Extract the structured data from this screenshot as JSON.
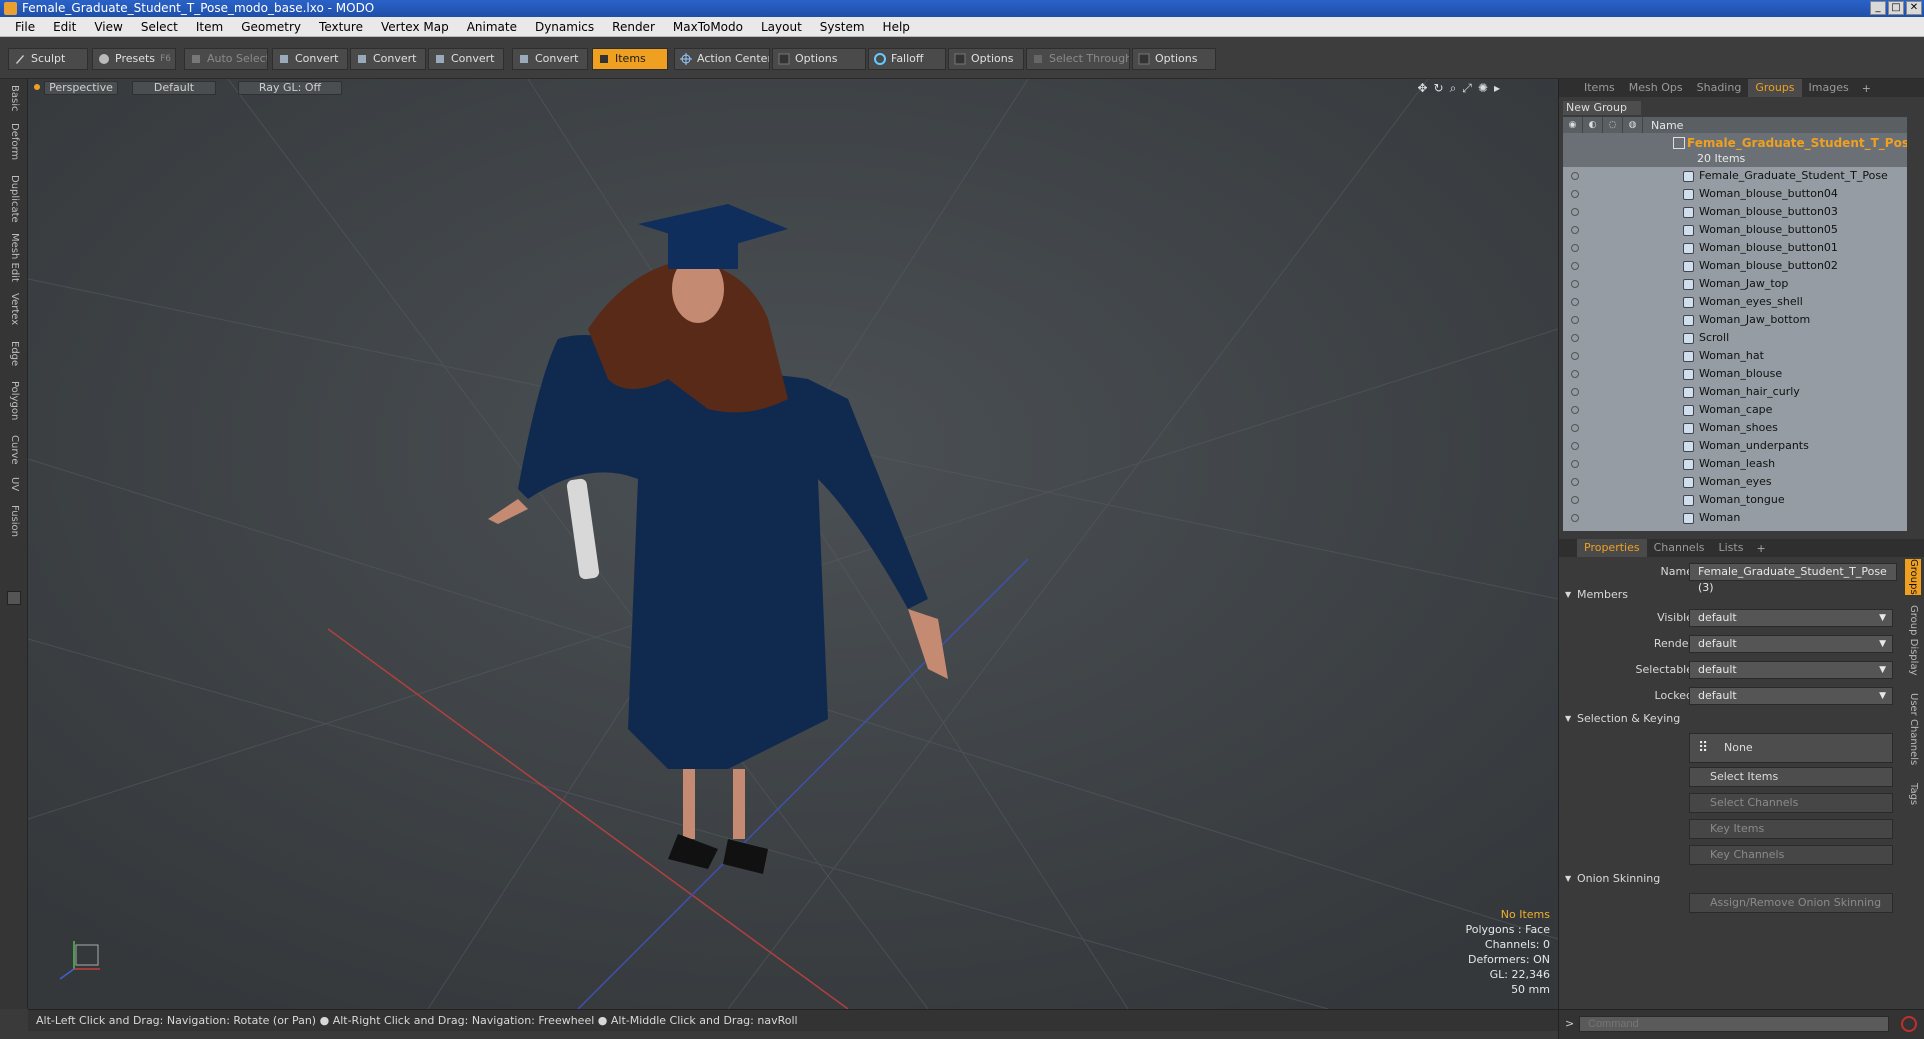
{
  "window": {
    "title": "Female_Graduate_Student_T_Pose_modo_base.lxo - MODO"
  },
  "menu": [
    "File",
    "Edit",
    "View",
    "Select",
    "Item",
    "Geometry",
    "Texture",
    "Vertex Map",
    "Animate",
    "Dynamics",
    "Render",
    "MaxToModo",
    "Layout",
    "System",
    "Help"
  ],
  "toolbar": {
    "sculpt": "Sculpt",
    "presets": "Presets",
    "presets_key": "F6",
    "auto_select": "Auto Select",
    "convert1": "Convert",
    "convert2": "Convert",
    "convert3": "Convert",
    "convert4": "Convert",
    "items": "Items",
    "action_center": "Action Center",
    "options1": "Options",
    "falloff": "Falloff",
    "options2": "Options",
    "select_through": "Select Through",
    "options3": "Options"
  },
  "left_tabs": [
    "Basic",
    "Deform",
    "Duplicate",
    "Mesh Edit",
    "Vertex",
    "Edge",
    "Polygon",
    "Curve",
    "UV",
    "Fusion"
  ],
  "viewport": {
    "view": "Perspective",
    "shading": "Default",
    "raygl": "Ray GL: Off",
    "info": {
      "no_items": "No Items",
      "polygons": "Polygons : Face",
      "channels": "Channels: 0",
      "deformers": "Deformers: ON",
      "gl": "GL: 22,346",
      "mm": "50 mm"
    }
  },
  "statusbar": {
    "text": "Alt-Left Click and Drag: Navigation: Rotate (or Pan) ● Alt-Right Click and Drag: Navigation: Freewheel ● Alt-Middle Click and Drag: navRoll"
  },
  "right_tabs": [
    "Items",
    "Mesh Ops",
    "Shading",
    "Groups",
    "Images"
  ],
  "groups": {
    "new_group": "New Group",
    "name_col": "Name",
    "group_name": "Female_Graduate_Student_T_Pose...",
    "group_count": "20 Items",
    "items": [
      "Female_Graduate_Student_T_Pose",
      "Woman_blouse_button04",
      "Woman_blouse_button03",
      "Woman_blouse_button05",
      "Woman_blouse_button01",
      "Woman_blouse_button02",
      "Woman_Jaw_top",
      "Woman_eyes_shell",
      "Woman_Jaw_bottom",
      "Scroll",
      "Woman_hat",
      "Woman_blouse",
      "Woman_hair_curly",
      "Woman_cape",
      "Woman_shoes",
      "Woman_underpants",
      "Woman_leash",
      "Woman_eyes",
      "Woman_tongue",
      "Woman"
    ]
  },
  "props_tabs": [
    "Properties",
    "Channels",
    "Lists"
  ],
  "properties": {
    "name_label": "Name",
    "name_value": "Female_Graduate_Student_T_Pose (3)",
    "members": "Members",
    "visible_label": "Visible",
    "visible_value": "default",
    "render_label": "Render",
    "render_value": "default",
    "selectable_label": "Selectable",
    "selectable_value": "default",
    "locked_label": "Locked",
    "locked_value": "default",
    "selection_keying": "Selection & Keying",
    "none": "None",
    "select_items": "Select Items",
    "select_channels": "Select Channels",
    "key_items": "Key Items",
    "key_channels": "Key Channels",
    "onion": "Onion Skinning",
    "assign_onion": "Assign/Remove Onion Skinning"
  },
  "side_vtabs": [
    "Groups",
    "Group Display",
    "User Channels",
    "Tags"
  ],
  "command": {
    "placeholder": "Command"
  }
}
